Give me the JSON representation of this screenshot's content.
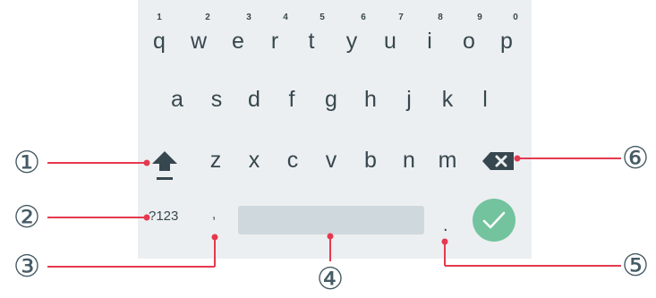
{
  "keyboard": {
    "row1": [
      {
        "letter": "q",
        "hint": "1"
      },
      {
        "letter": "w",
        "hint": "2"
      },
      {
        "letter": "e",
        "hint": "3"
      },
      {
        "letter": "r",
        "hint": "4"
      },
      {
        "letter": "t",
        "hint": "5"
      },
      {
        "letter": "y",
        "hint": "6"
      },
      {
        "letter": "u",
        "hint": "7"
      },
      {
        "letter": "i",
        "hint": "8"
      },
      {
        "letter": "o",
        "hint": "9"
      },
      {
        "letter": "p",
        "hint": "0"
      }
    ],
    "row2": [
      "a",
      "s",
      "d",
      "f",
      "g",
      "h",
      "j",
      "k",
      "l"
    ],
    "row3": [
      "z",
      "x",
      "c",
      "v",
      "b",
      "n",
      "m"
    ],
    "symbols_label": "?123",
    "comma_label": ",",
    "period_label": ".",
    "shift_icon": "shift-arrow-up",
    "backspace_icon": "backspace-x",
    "enter_icon": "checkmark",
    "enter_color": "#73c39f"
  },
  "callouts": [
    "①",
    "②",
    "③",
    "④",
    "⑤",
    "⑥"
  ],
  "colors": {
    "keyboard_bg": "#eceff1",
    "key_text": "#37474f",
    "leader_line": "#e53950",
    "spacebar": "#cfd8dc"
  }
}
